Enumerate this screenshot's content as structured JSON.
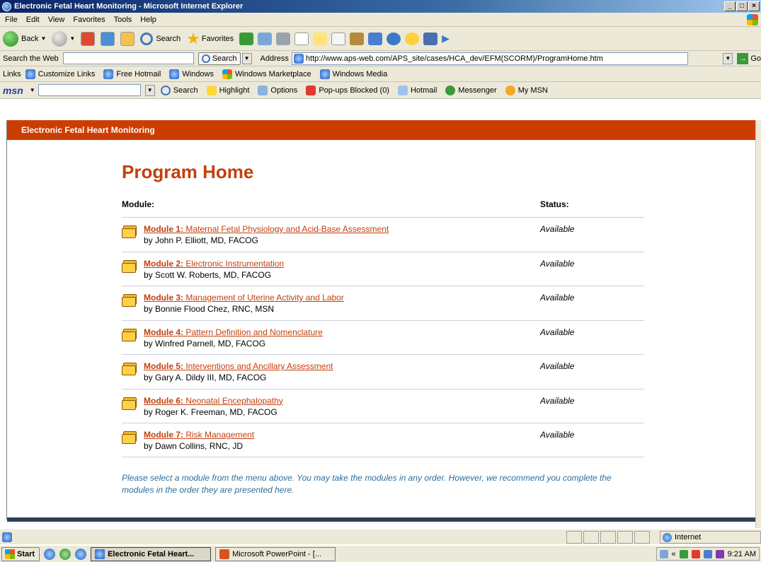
{
  "window": {
    "title": "Electronic Fetal Heart Monitoring - Microsoft Internet Explorer",
    "controls": [
      "_",
      "□",
      "×"
    ]
  },
  "menu": [
    "File",
    "Edit",
    "View",
    "Favorites",
    "Tools",
    "Help"
  ],
  "toolbar": {
    "back_label": "Back",
    "search_label": "Search",
    "favorites_label": "Favorites"
  },
  "searchbar": {
    "search_the_web_label": "Search the Web",
    "search_button": "Search",
    "address_label": "Address",
    "address_url": "http://www.aps-web.com/APS_site/cases/HCA_dev/EFM(SCORM)/ProgramHome.htm",
    "go_label": "Go"
  },
  "links": {
    "label": "Links",
    "items": [
      "Customize Links",
      "Free Hotmail",
      "Windows",
      "Windows Marketplace",
      "Windows Media"
    ]
  },
  "msnbar": {
    "logo": "msn",
    "items": [
      "Search",
      "Highlight",
      "Options",
      "Pop-ups Blocked (0)",
      "Hotmail",
      "Messenger",
      "My MSN"
    ]
  },
  "page": {
    "header": "Electronic Fetal Heart Monitoring",
    "title": "Program Home",
    "col_module": "Module:",
    "col_status": "Status:",
    "modules": [
      {
        "number": "Module 1:",
        "name": "Maternal Fetal Physiology and Acid-Base Assessment",
        "author": "by John P. Elliott, MD, FACOG",
        "status": "Available"
      },
      {
        "number": "Module 2:",
        "name": "Electronic Instrumentation",
        "author": "by Scott W. Roberts, MD, FACOG",
        "status": "Available"
      },
      {
        "number": "Module 3:",
        "name": "Management of Uterine Activity and Labor",
        "author": "by Bonnie Flood Chez, RNC, MSN",
        "status": "Available"
      },
      {
        "number": "Module 4:",
        "name": "Pattern Definition and Nomenclature",
        "author": "by Winfred Parnell, MD, FACOG",
        "status": "Available"
      },
      {
        "number": "Module 5:",
        "name": "Interventions and Ancillary Assessment",
        "author": "by Gary A. Dildy III, MD, FACOG",
        "status": "Available"
      },
      {
        "number": "Module 6:",
        "name": "Neonatal Encephalopathy",
        "author": "by Roger K. Freeman, MD, FACOG",
        "status": "Available"
      },
      {
        "number": "Module 7:",
        "name": "Risk Management",
        "author": "by Dawn Collins, RNC, JD",
        "status": "Available"
      }
    ],
    "note": "Please select a module from the menu above. You may take the modules in any order. However, we recommend you complete the modules in the order they are presented here."
  },
  "status": {
    "zone": "Internet"
  },
  "taskbar": {
    "start": "Start",
    "tasks": [
      "Electronic Fetal Heart...",
      "Microsoft PowerPoint - [..."
    ],
    "clock": "9:21 AM"
  },
  "colors": {
    "header_bg": "#cc3d03",
    "title_color": "#c3400f",
    "note_color": "#2e6e99"
  }
}
